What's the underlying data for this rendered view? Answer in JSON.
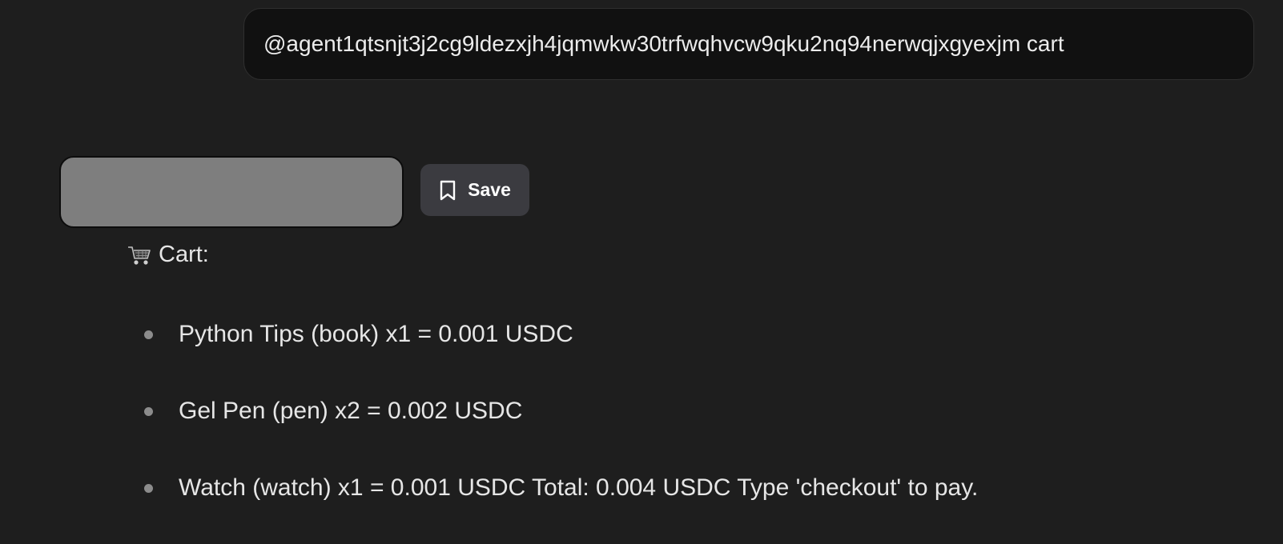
{
  "user_message": {
    "text": "@agent1qtsnjt3j2cg9ldezxjh4jqmwkw30trfwqhvcw9qku2nq94nerwqjxgyexjm cart"
  },
  "assistant_message": {
    "save_button": {
      "label": "Save",
      "icon": "bookmark-icon"
    },
    "cart": {
      "heading_icon": "shopping-cart-icon",
      "heading": "Cart:",
      "items": [
        {
          "text": "Python Tips (book) x1 = 0.001 USDC"
        },
        {
          "text": "Gel Pen (pen) x2 = 0.002 USDC"
        },
        {
          "text": "Watch (watch) x1 = 0.001 USDC Total: 0.004 USDC Type 'checkout' to pay."
        }
      ]
    }
  },
  "colors": {
    "background": "#1e1e1e",
    "user_bubble": "#111111",
    "save_button": "#3b3b40",
    "placeholder": "#7e7e7e"
  }
}
